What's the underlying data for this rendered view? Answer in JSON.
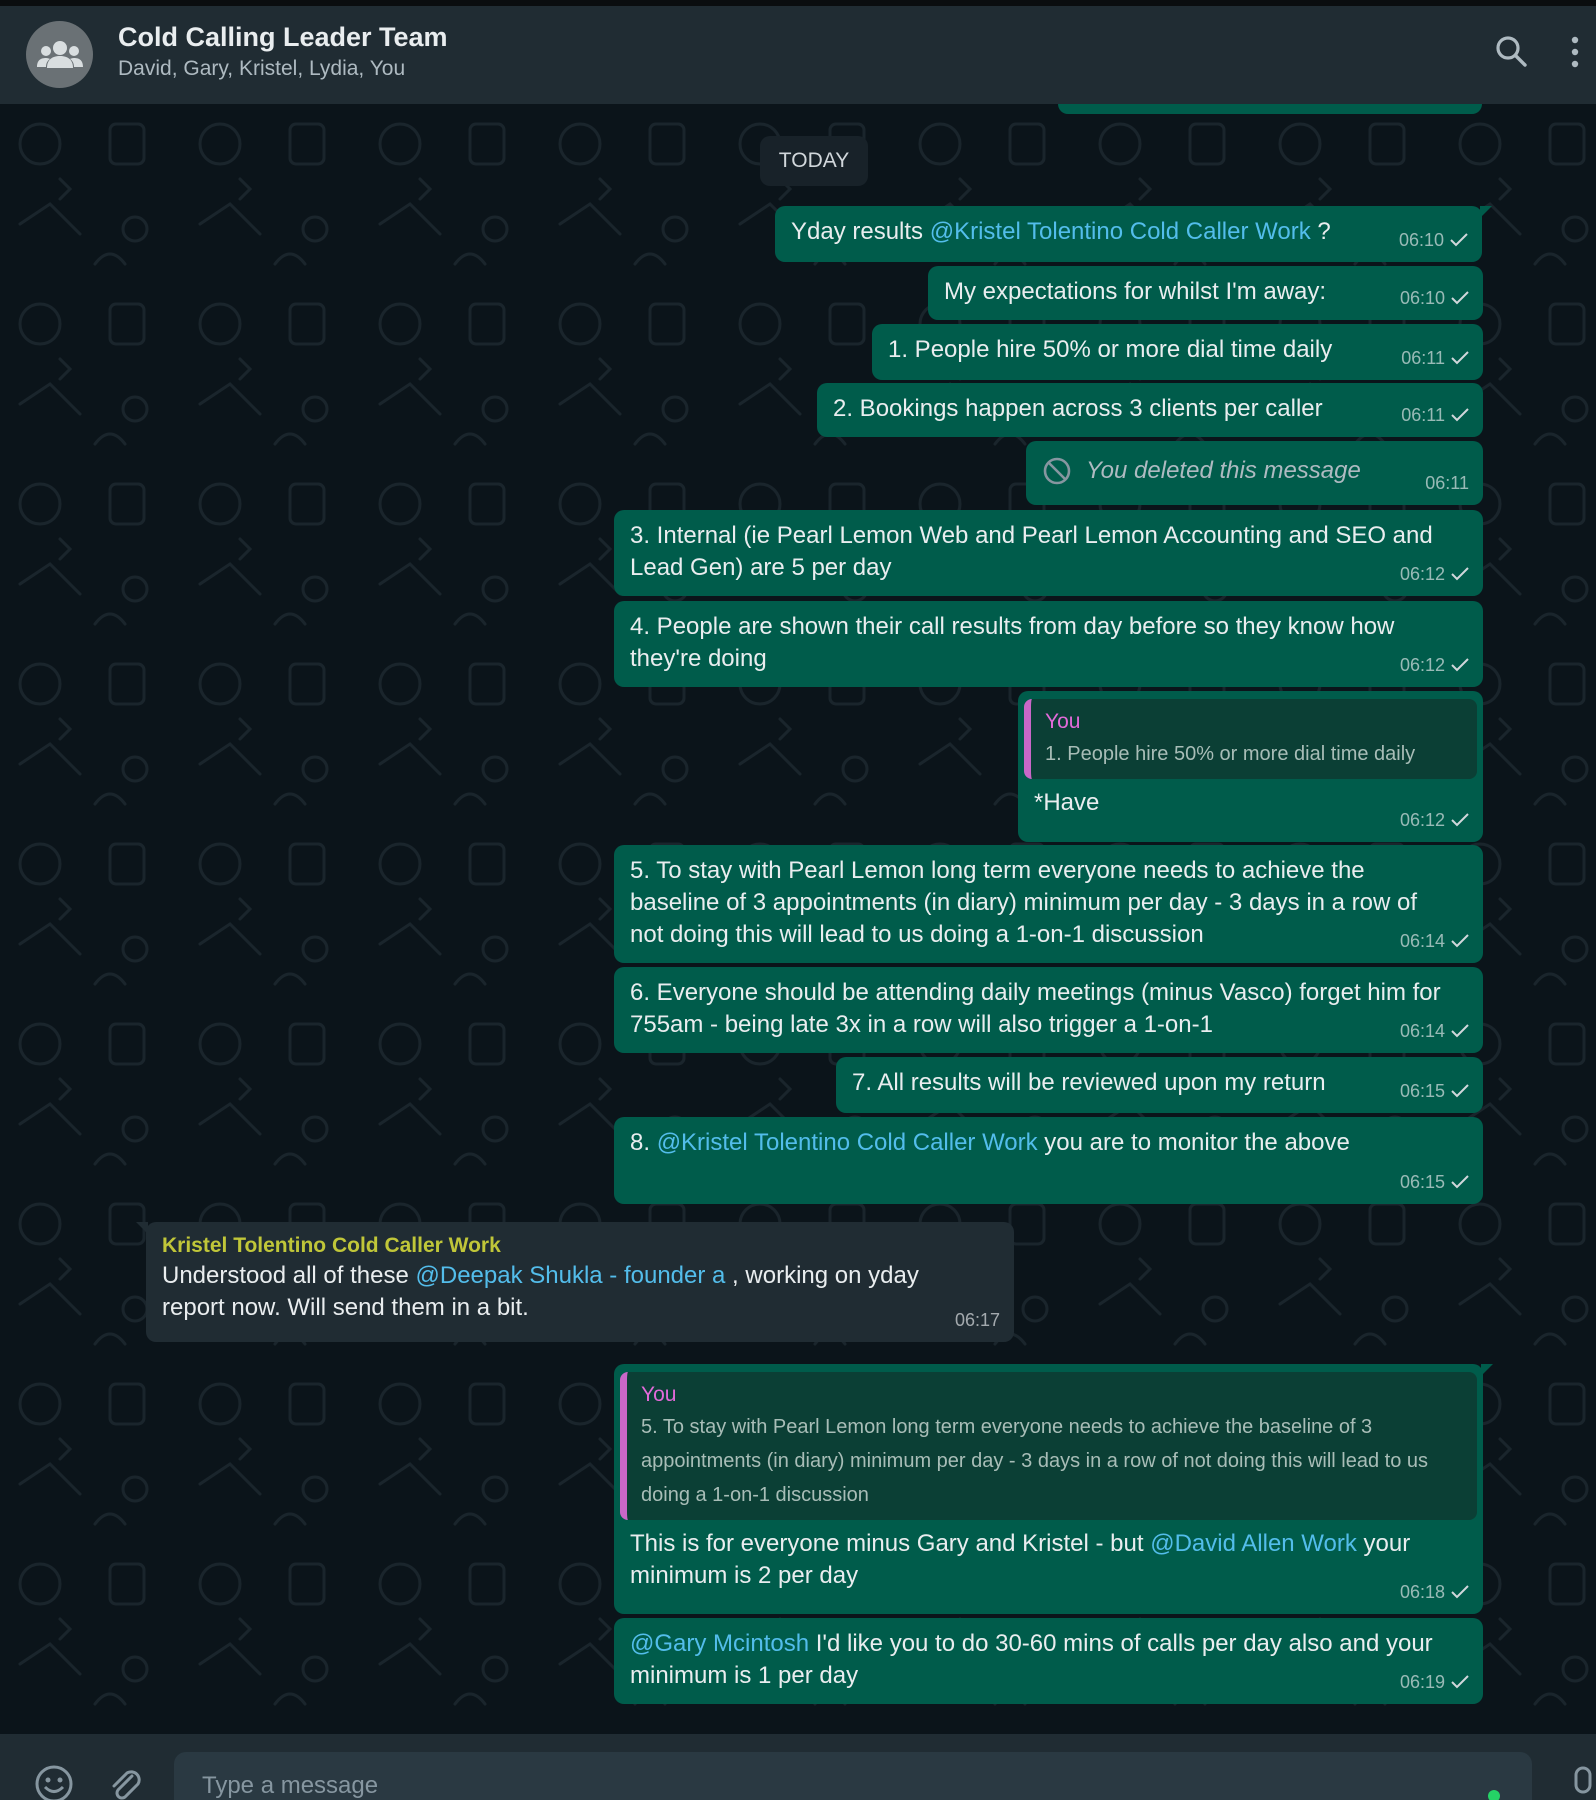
{
  "header": {
    "title": "Cold Calling Leader Team",
    "members": "David, Gary, Kristel, Lydia, You"
  },
  "day_separator": "TODAY",
  "messages": [
    {
      "dir": "out",
      "parts": [
        "Yday results ",
        "@Kristel Tolentino Cold Caller Work",
        " ?"
      ],
      "time": "06:10"
    },
    {
      "dir": "out",
      "text": "My expectations for whilst I'm away:",
      "time": "06:10"
    },
    {
      "dir": "out",
      "text": "1. People hire 50% or more dial time daily",
      "time": "06:11"
    },
    {
      "dir": "out",
      "text": "2. Bookings happen across 3 clients per caller",
      "time": "06:11"
    },
    {
      "dir": "out",
      "deleted": true,
      "text": "You deleted this message",
      "time": "06:11"
    },
    {
      "dir": "out",
      "text": "3. Internal (ie Pearl Lemon Web and Pearl Lemon Accounting and SEO and Lead Gen) are 5 per day",
      "time": "06:12"
    },
    {
      "dir": "out",
      "text": "4. People are shown their call results from day before so they know how they're doing",
      "time": "06:12"
    },
    {
      "dir": "out",
      "quote_name": "You",
      "quote_text": "1. People hire 50% or more dial time daily",
      "text": "*Have",
      "time": "06:12"
    },
    {
      "dir": "out",
      "text": "5. To stay with Pearl Lemon long term everyone needs to achieve the baseline of 3 appointments (in diary) minimum per day - 3 days in a row of not doing this will lead to us doing a 1-on-1 discussion",
      "time": "06:14"
    },
    {
      "dir": "out",
      "text": "6. Everyone should be attending daily meetings (minus Vasco) forget him for 755am - being late 3x in a row will also trigger a 1-on-1",
      "time": "06:14"
    },
    {
      "dir": "out",
      "text": "7. All results will be reviewed upon my return",
      "time": "06:15"
    },
    {
      "dir": "out",
      "parts": [
        "8. ",
        "@Kristel Tolentino Cold Caller Work",
        " you are to monitor the above"
      ],
      "time": "06:15"
    },
    {
      "dir": "in",
      "sender": "Kristel Tolentino Cold Caller Work",
      "parts": [
        "Understood all of these ",
        "@Deepak Shukla - founder a",
        " , working on yday report now. Will send them in a bit."
      ],
      "time": "06:17"
    },
    {
      "dir": "out",
      "quote_name": "You",
      "quote_text": "5. To stay with Pearl Lemon long term everyone needs to achieve the baseline of 3 appointments (in diary) minimum per day - 3 days in a row of not doing this will lead to us doing a 1-on-1 discussion",
      "parts": [
        "This is for everyone minus Gary and Kristel - but ",
        "@David Allen Work",
        " your minimum is 2 per day"
      ],
      "time": "06:18"
    },
    {
      "dir": "out",
      "parts": [
        "",
        "@Gary Mcintosh",
        " I'd like you to do 30-60 mins of calls per day also and your minimum is 1 per day"
      ],
      "time": "06:19"
    }
  ],
  "composer": {
    "placeholder": "Type a message"
  },
  "icons": [
    "group-avatar-icon",
    "search-icon",
    "menu-icon",
    "emoji-icon",
    "attach-icon",
    "mic-icon",
    "check-icon",
    "deleted-icon"
  ],
  "colors": {
    "outgoing_bubble": "#005c4b",
    "incoming_bubble": "#202c33",
    "mention": "#53bdeb",
    "quote_accent": "#c967c8",
    "sender_name": "#c0c639"
  }
}
